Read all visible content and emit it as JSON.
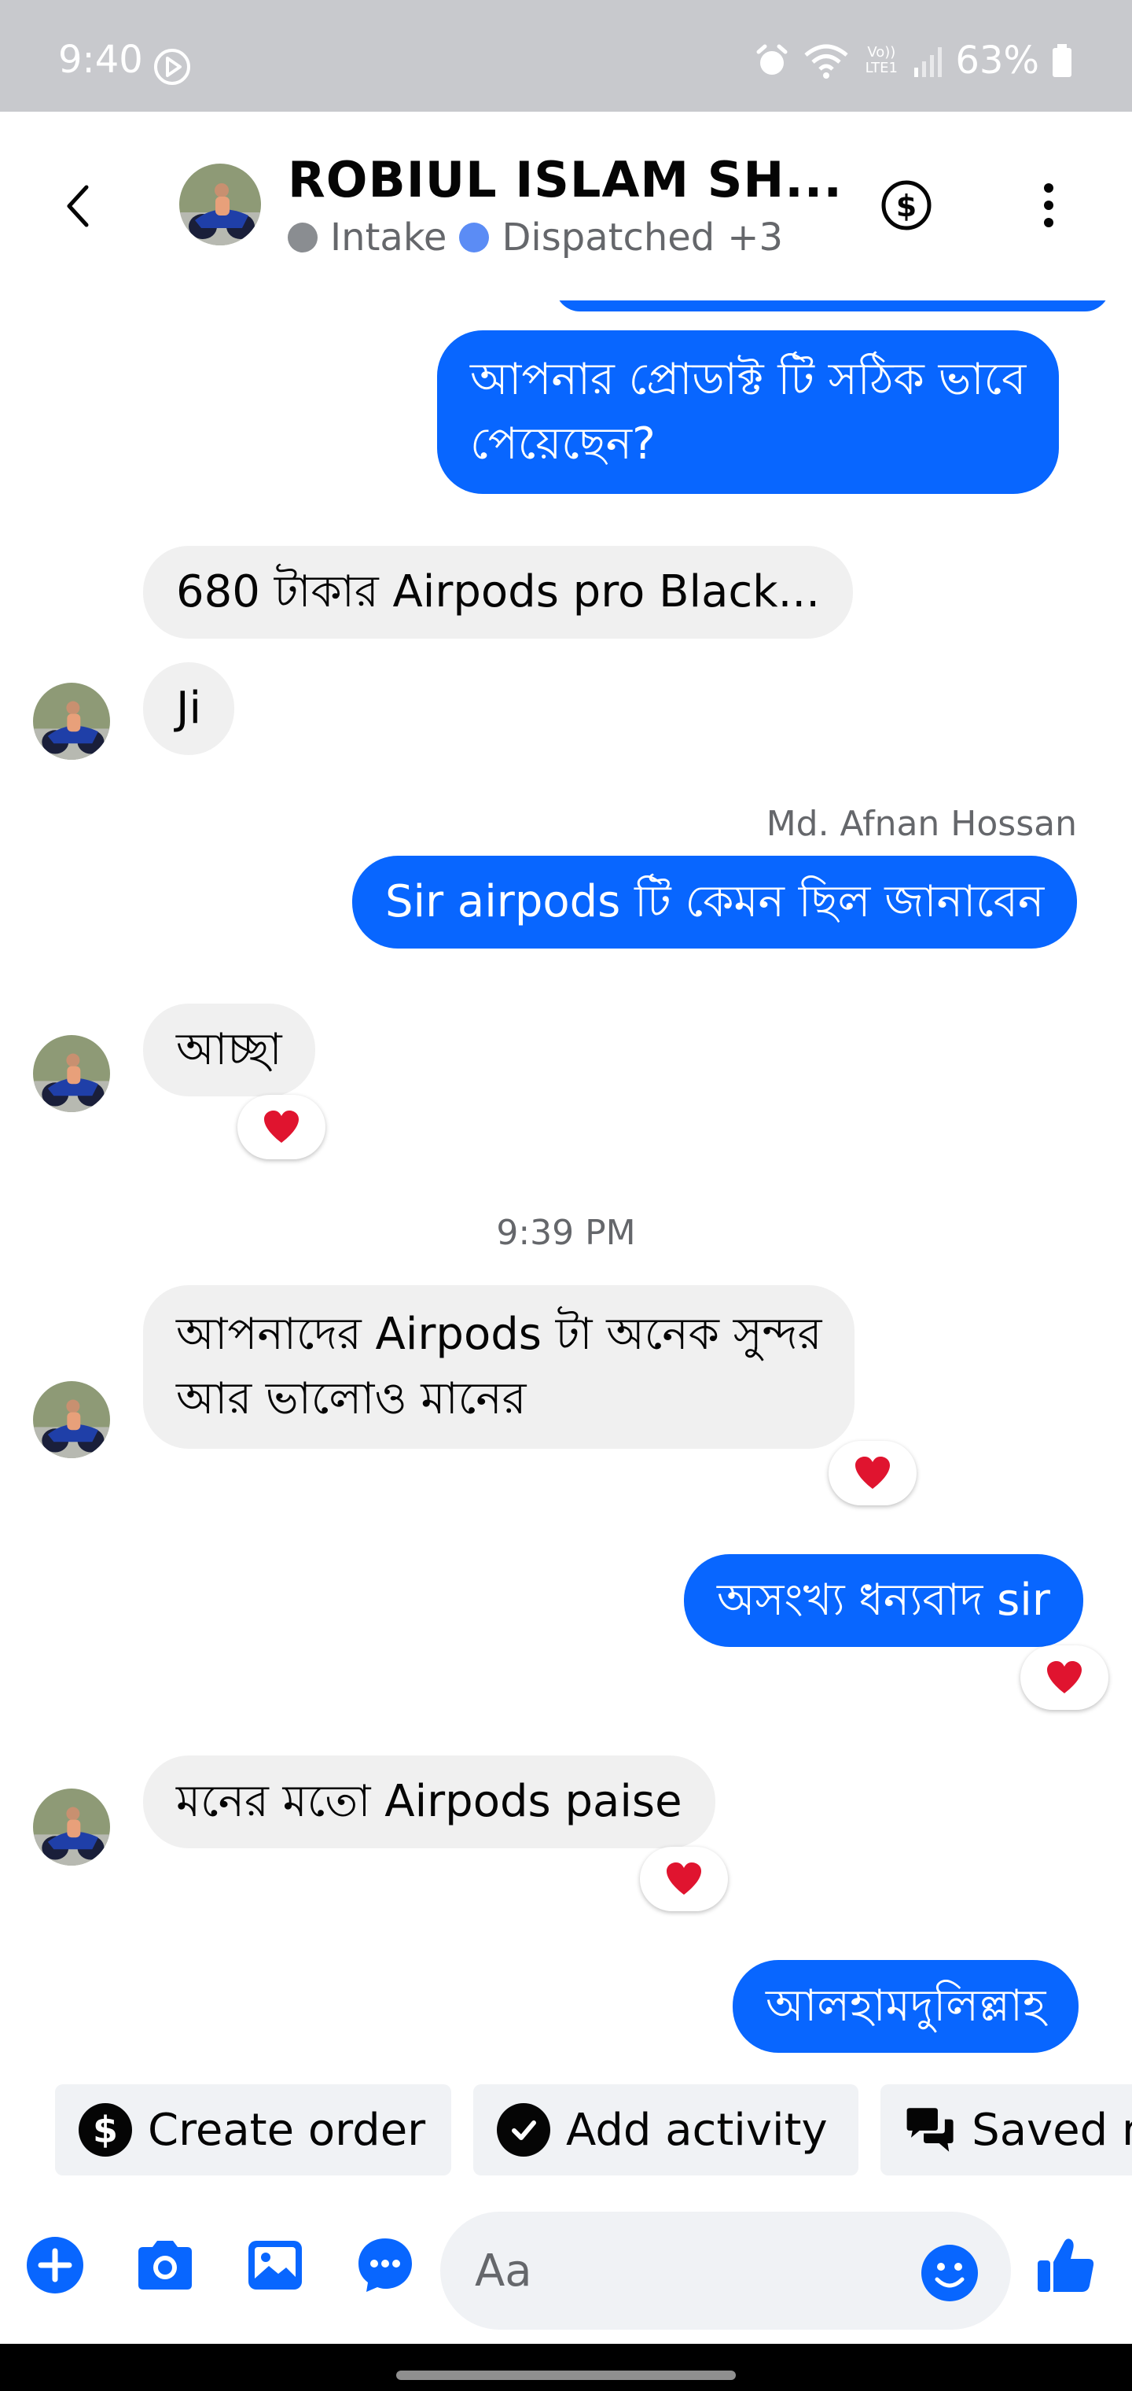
{
  "status_bar": {
    "time": "9:40",
    "network_label": "Vo)) LTE1",
    "battery": "63%"
  },
  "header": {
    "contact_name": "ROBIUL ISLAM SH...",
    "labels": [
      {
        "text": "Intake",
        "color": "#8a8d91"
      },
      {
        "text": "Dispatched",
        "color": "#5b8cf5"
      },
      {
        "text": "+3"
      }
    ]
  },
  "messages": {
    "m0": "",
    "m1": "আপনার প্রোডাক্ট টি সঠিক ভাবে\nপেয়েছেন?",
    "m2": "680 টাকার Airpods pro Black...",
    "m3": "Ji",
    "sender": "Md. Afnan Hossan",
    "m4": "Sir airpods টি কেমন ছিল জানাবেন",
    "m5": "আচ্ছা",
    "timestamp": "9:39 PM",
    "m6": "আপনাদের Airpods  টা অনেক সুন্দর\nআর ভালোও মানের",
    "m7": "অসংখ্য ধন্যবাদ sir",
    "m8": "মনের মতো Airpods paise",
    "m9": "আলহামদুলিল্লাহ"
  },
  "quick_actions": {
    "create_order": "Create order",
    "add_activity": "Add activity",
    "saved_replies": "Saved r"
  },
  "composer": {
    "placeholder": "Aa"
  },
  "colors": {
    "accent": "#0866ff",
    "incoming_bubble": "#f0f0f0",
    "status_bar": "#c8c9cd",
    "reaction_heart": "#e0142f"
  },
  "icons": [
    "back-arrow-icon",
    "dollar-icon",
    "more-icon",
    "heart-icon",
    "plus-icon",
    "camera-icon",
    "gallery-icon",
    "quick-reply-icon",
    "emoji-icon",
    "like-icon"
  ]
}
